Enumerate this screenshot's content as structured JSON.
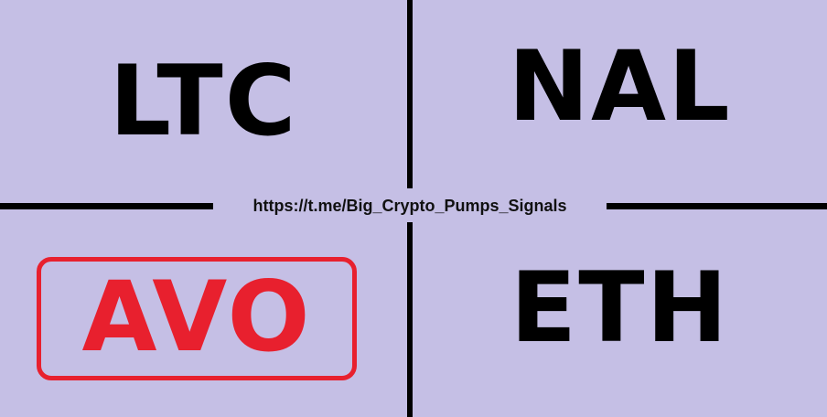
{
  "tickers": {
    "top_left": "LTC",
    "top_right": "NAL",
    "bottom_left": "AVO",
    "bottom_right": "ETH"
  },
  "link": "https://t.me/Big_Crypto_Pumps_Signals",
  "colors": {
    "background": "#c5bfe5",
    "divider": "#000000",
    "highlight": "#e8202e"
  }
}
